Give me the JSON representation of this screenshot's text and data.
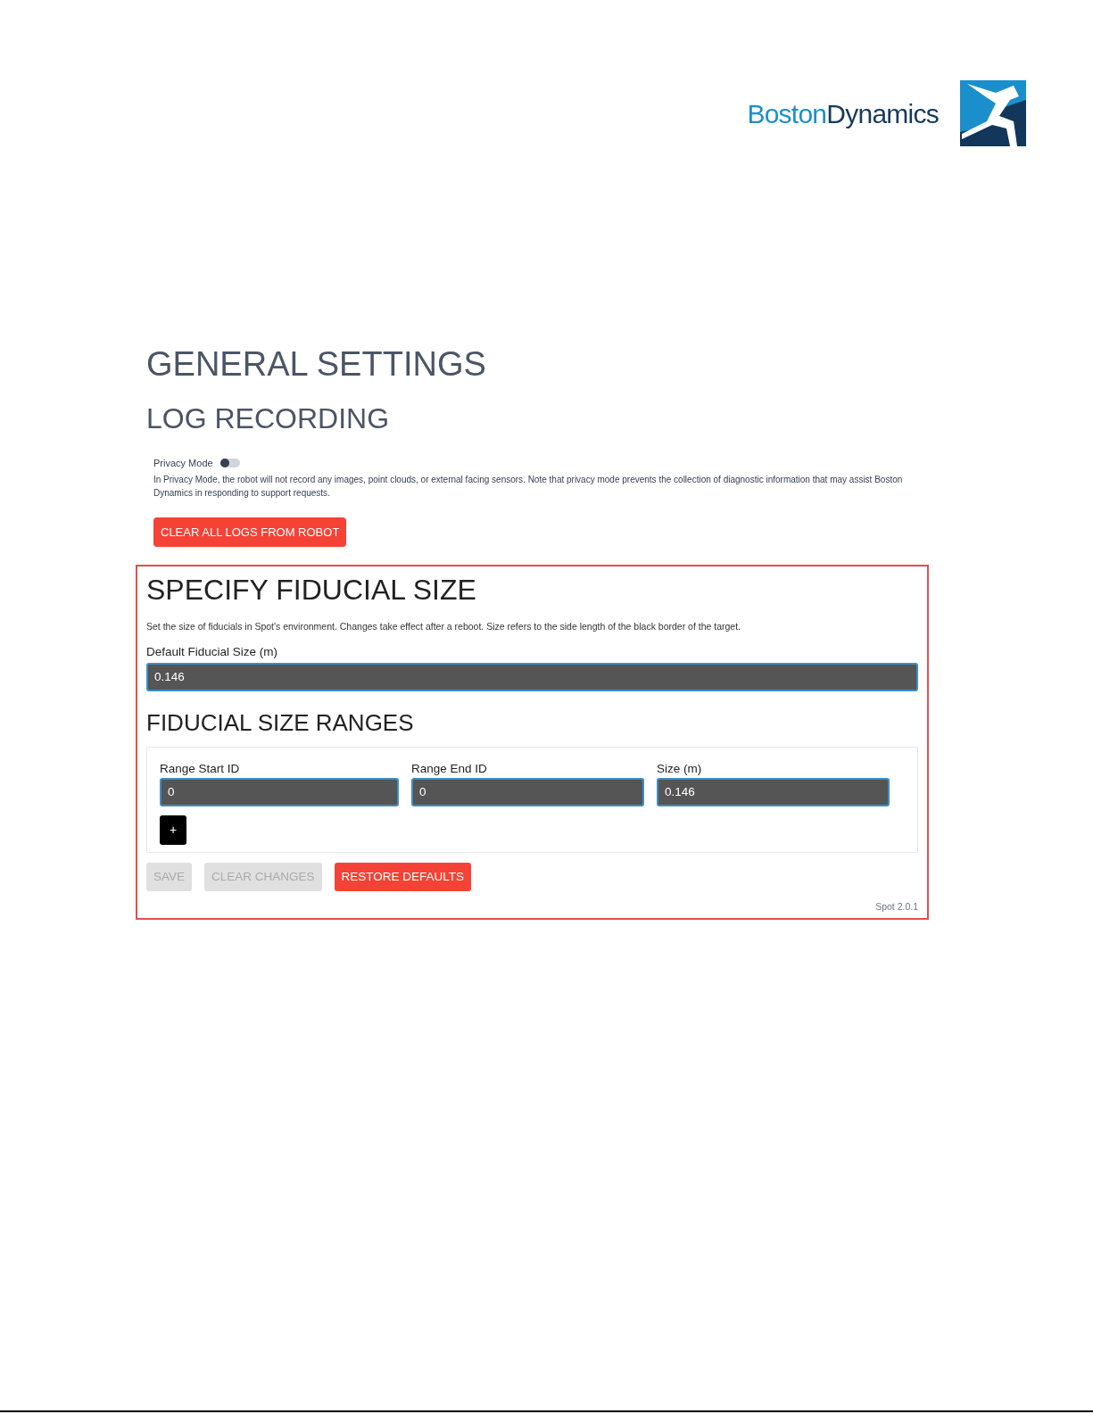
{
  "logo": {
    "word_1": "Boston",
    "word_2": "Dynamics"
  },
  "general": {
    "title": "GENERAL SETTINGS",
    "subtitle": "LOG RECORDING",
    "privacy": {
      "label": "Privacy Mode",
      "on": false
    },
    "description": "In Privacy Mode, the robot will not record any images, point clouds, or external facing sensors. Note that privacy mode prevents the collection of diagnostic information that may assist Boston Dynamics in responding to support requests.",
    "clear_button": "CLEAR ALL LOGS FROM ROBOT"
  },
  "fiducial": {
    "title": "SPECIFY FIDUCIAL SIZE",
    "description": "Set the size of fiducials in Spot's environment. Changes take effect after a reboot. Size refers to the side length of the black border of the target.",
    "default_label": "Default Fiducial Size (m)",
    "default_value": "0.146",
    "ranges_title": "FIDUCIAL SIZE RANGES",
    "ranges": [
      {
        "label": "Range Start ID",
        "value": "0"
      },
      {
        "label": "Range End ID",
        "value": "0"
      },
      {
        "label": "Size (m)",
        "value": "0.146"
      }
    ],
    "add_button": "+",
    "buttons": [
      {
        "label": "SAVE",
        "disabled": true
      },
      {
        "label": "CLEAR CHANGES",
        "disabled": true
      },
      {
        "label": "RESTORE DEFAULTS",
        "disabled": false
      }
    ],
    "version": "Spot 2.0.1"
  }
}
